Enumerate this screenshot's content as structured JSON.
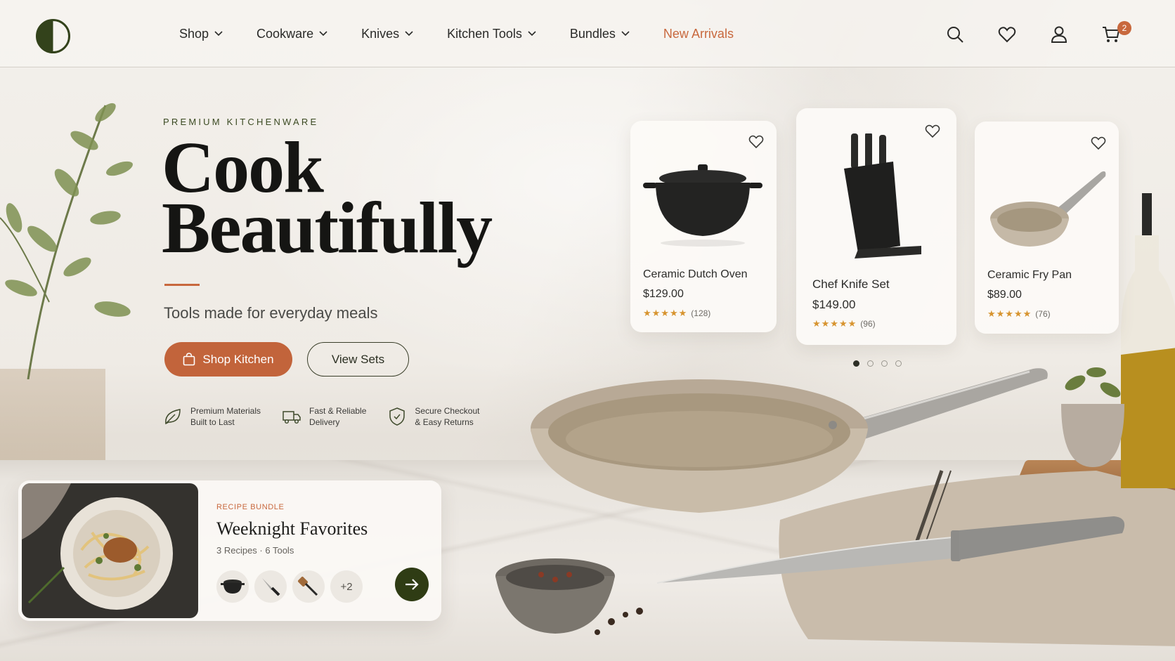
{
  "nav": {
    "items": [
      {
        "label": "Shop",
        "has_dropdown": true
      },
      {
        "label": "Cookware",
        "has_dropdown": true
      },
      {
        "label": "Knives",
        "has_dropdown": true
      },
      {
        "label": "Kitchen Tools",
        "has_dropdown": true
      },
      {
        "label": "Bundles",
        "has_dropdown": true
      },
      {
        "label": "New Arrivals",
        "has_dropdown": false
      }
    ],
    "icons": [
      "search-icon",
      "heart-icon",
      "user-icon",
      "cart-icon"
    ],
    "cart_count": "2"
  },
  "hero": {
    "eyebrow": "PREMIUM KITCHENWARE",
    "headline_line1": "Cook",
    "headline_line2": "Beautifully",
    "subhead": "Tools made for everyday meals",
    "primary_cta": "Shop Kitchen",
    "secondary_cta": "View Sets"
  },
  "features": [
    {
      "line1": "Premium Materials",
      "line2": "Built to Last",
      "icon": "leaf-icon"
    },
    {
      "line1": "Fast & Reliable",
      "line2": "Delivery",
      "icon": "truck-icon"
    },
    {
      "line1": "Secure Checkout",
      "line2": "& Easy Returns",
      "icon": "shield-icon"
    }
  ],
  "products": [
    {
      "name": "Ceramic Dutch Oven",
      "price": "$129.00",
      "stars": "★★★★★",
      "reviews": "(128)",
      "rating": 4.5
    },
    {
      "name": "Chef Knife Set",
      "price": "$149.00",
      "stars": "★★★★★",
      "reviews": "(96)",
      "rating": 4.5
    },
    {
      "name": "Ceramic Fry Pan",
      "price": "$89.00",
      "stars": "★★★★★",
      "reviews": "(76)",
      "rating": 4.5
    }
  ],
  "carousel": {
    "pages": 4,
    "active": 1
  },
  "bundle": {
    "tag": "RECIPE BUNDLE",
    "title": "Weeknight Favorites",
    "meta": "3 Recipes · 6 Tools",
    "more": "+2"
  },
  "colors": {
    "accent": "#c2643b",
    "brand_dark": "#2f3c14",
    "star": "#d7942f"
  }
}
